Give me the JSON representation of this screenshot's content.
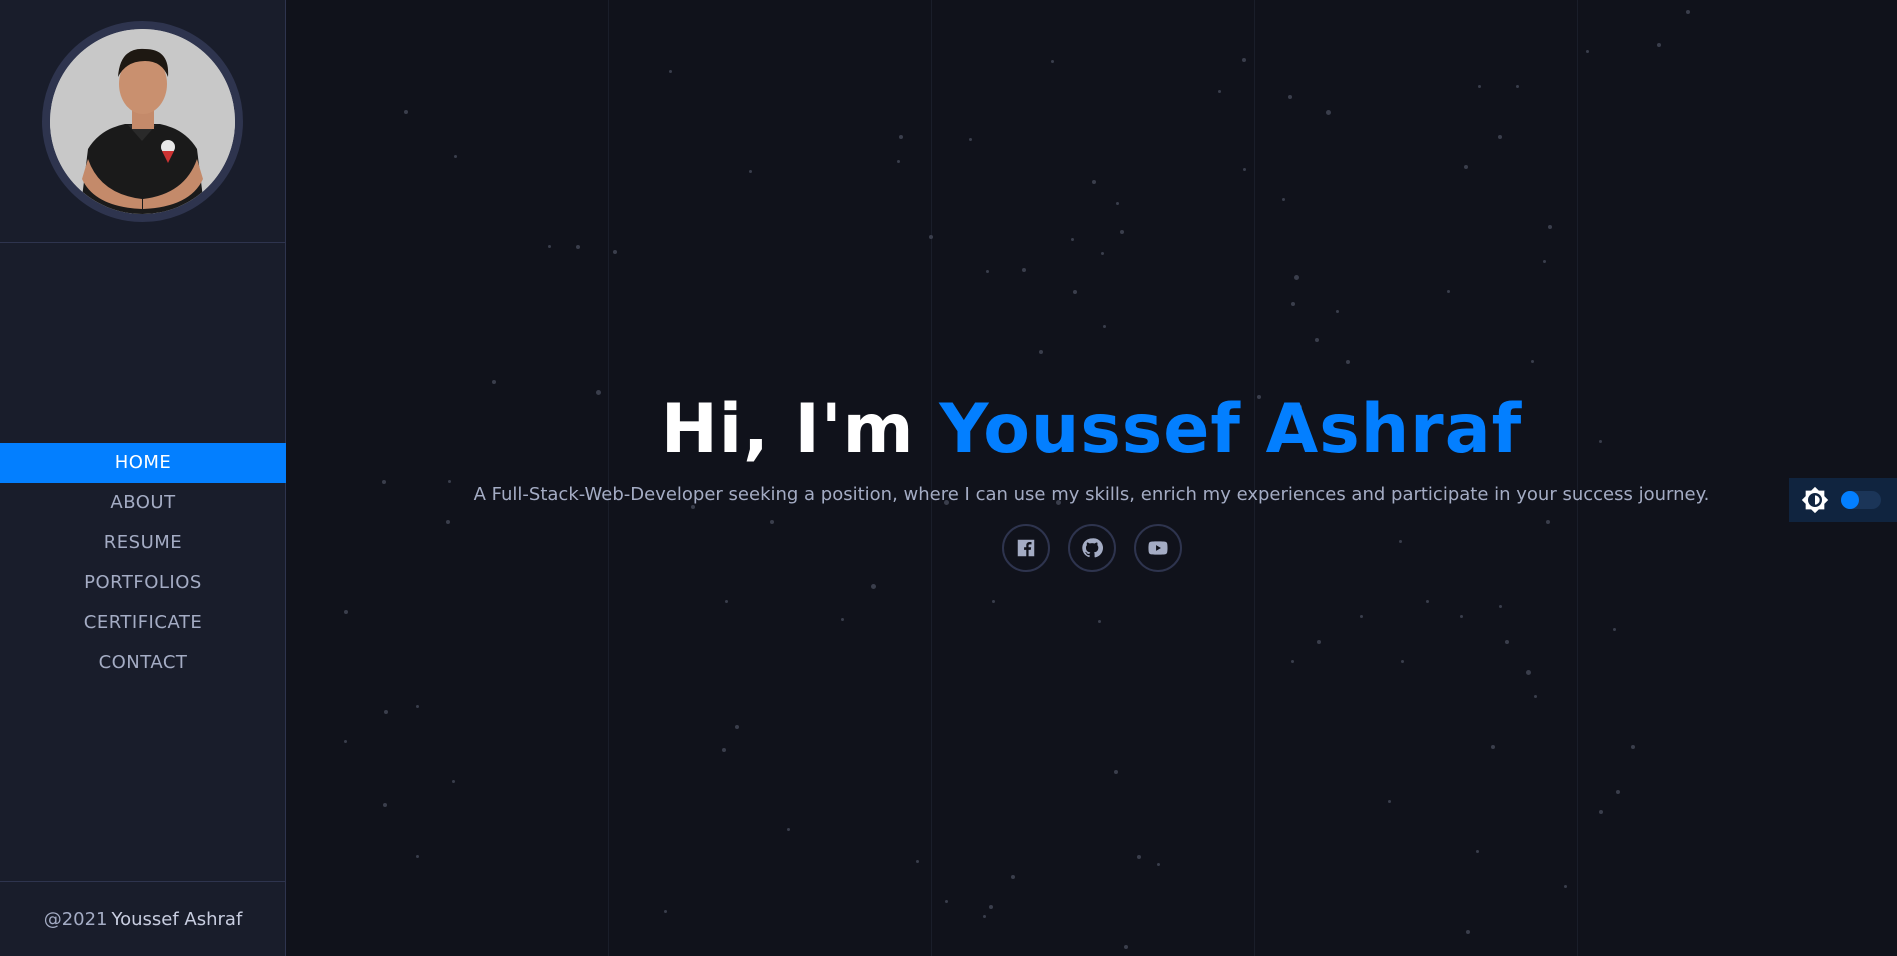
{
  "profile": {
    "avatar_alt": "Youssef Ashraf portrait"
  },
  "nav": {
    "items": [
      {
        "label": "HOME",
        "active": true
      },
      {
        "label": "ABOUT",
        "active": false
      },
      {
        "label": "RESUME",
        "active": false
      },
      {
        "label": "PORTFOLIOS",
        "active": false
      },
      {
        "label": "CERTIFICATE",
        "active": false
      },
      {
        "label": "CONTACT",
        "active": false
      }
    ]
  },
  "footer": {
    "year": "@2021",
    "name": "Youssef Ashraf"
  },
  "hero": {
    "greeting": "Hi, I'm ",
    "name": "Youssef Ashraf",
    "tagline": "A Full-Stack-Web-Developer seeking a position, where I can use my skills, enrich my experiences and participate in your success journey."
  },
  "socials": [
    {
      "icon": "facebook-icon"
    },
    {
      "icon": "github-icon"
    },
    {
      "icon": "youtube-icon"
    }
  ],
  "theme": {
    "icon": "brightness-icon",
    "dark_mode": true
  },
  "colors": {
    "accent": "#037fff",
    "background": "#10121b",
    "sidebar": "#191d2b",
    "text": "#a4acc4"
  }
}
